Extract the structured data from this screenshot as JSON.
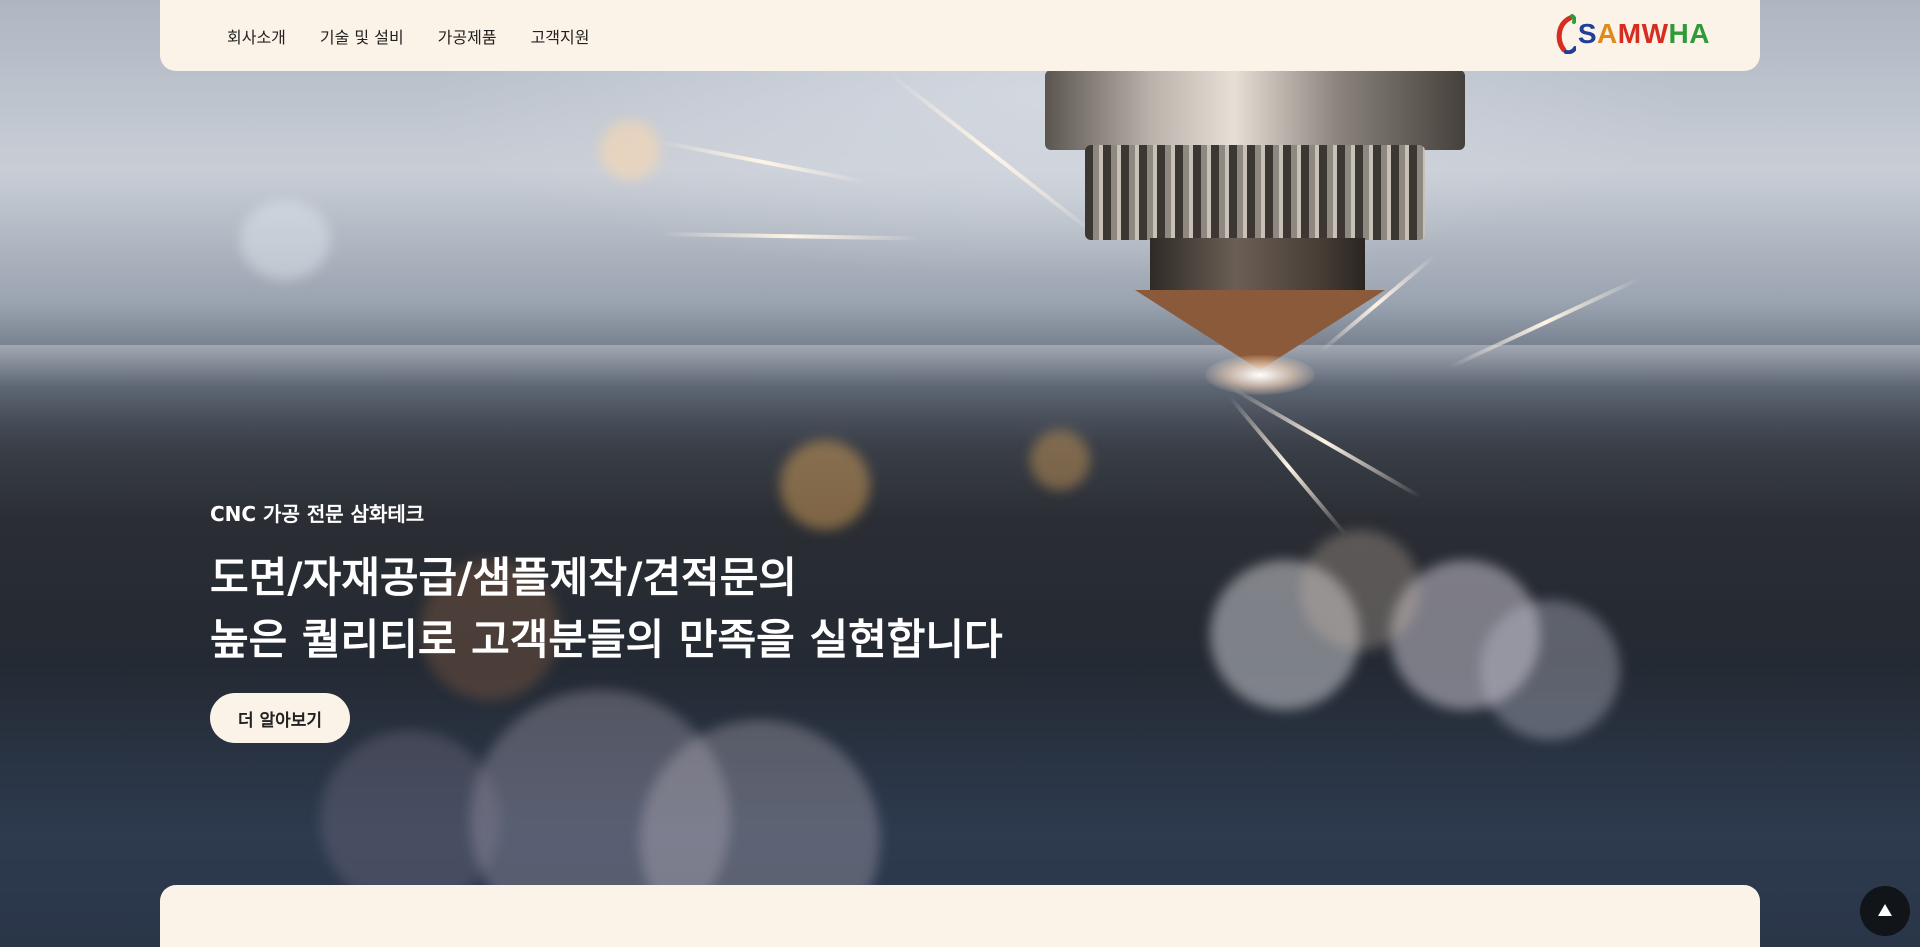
{
  "nav": {
    "items": [
      {
        "label": "회사소개"
      },
      {
        "label": "기술 및 설비"
      },
      {
        "label": "가공제품"
      },
      {
        "label": "고객지원"
      }
    ]
  },
  "brand": {
    "letters": [
      {
        "char": "S",
        "color": "#1f3f9a"
      },
      {
        "char": "A",
        "color": "#e08a1a"
      },
      {
        "char": "M",
        "color": "#d62d20"
      },
      {
        "char": "W",
        "color": "#d62d20"
      },
      {
        "char": "H",
        "color": "#2e9a3a"
      },
      {
        "char": "A",
        "color": "#2e9a3a"
      }
    ]
  },
  "hero": {
    "subtitle": "CNC 가공 전문 삼화테크",
    "title_line1": "도면/자재공급/샘플제작/견적문의",
    "title_line2": "높은 퀄리티로 고객분들의 만족을 실현합니다",
    "cta_label": "더 알아보기"
  },
  "icons": {
    "scroll_top": "arrow-up-icon",
    "logo": "samwha-logo-icon"
  },
  "colors": {
    "card_bg": "#fcf3e8",
    "scroll_btn_bg": "#111418",
    "text_light": "#ffffff",
    "text_dark": "#222222"
  }
}
